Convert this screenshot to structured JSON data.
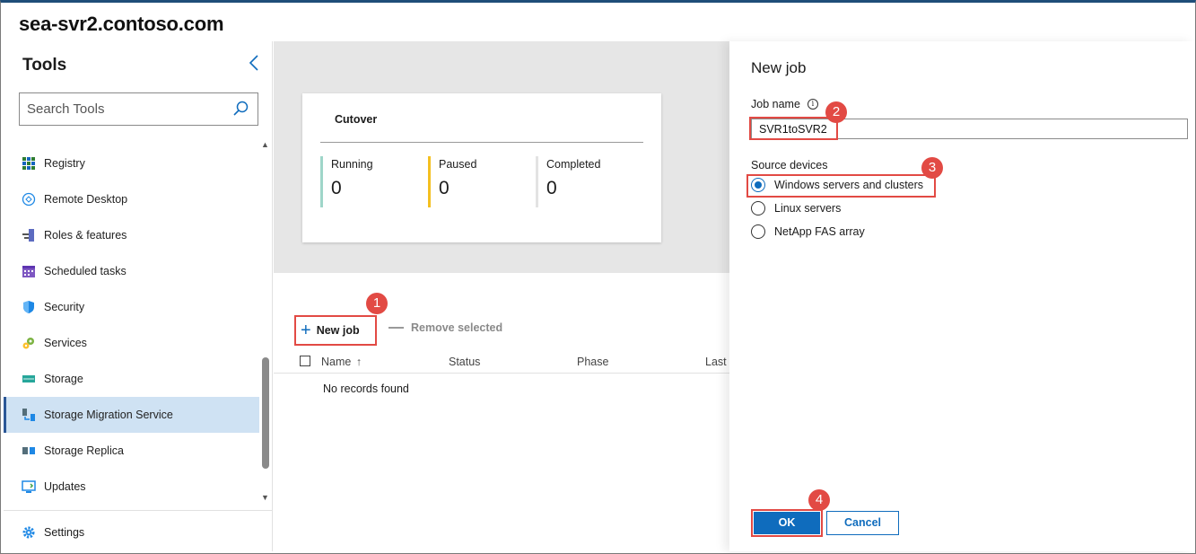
{
  "window": {
    "server_name": "sea-svr2.contoso.com"
  },
  "sidebar": {
    "title": "Tools",
    "search": {
      "placeholder": "Search Tools",
      "value": ""
    },
    "items": [
      {
        "label": "Registry",
        "icon": "registry-icon",
        "active": false
      },
      {
        "label": "Remote Desktop",
        "icon": "remote-desktop-icon",
        "active": false
      },
      {
        "label": "Roles & features",
        "icon": "roles-features-icon",
        "active": false
      },
      {
        "label": "Scheduled tasks",
        "icon": "calendar-icon",
        "active": false
      },
      {
        "label": "Security",
        "icon": "shield-icon",
        "active": false
      },
      {
        "label": "Services",
        "icon": "gears-icon",
        "active": false
      },
      {
        "label": "Storage",
        "icon": "storage-icon",
        "active": false
      },
      {
        "label": "Storage Migration Service",
        "icon": "migration-icon",
        "active": true
      },
      {
        "label": "Storage Replica",
        "icon": "replica-icon",
        "active": false
      },
      {
        "label": "Updates",
        "icon": "updates-icon",
        "active": false
      }
    ],
    "settings_label": "Settings"
  },
  "summary_card": {
    "title": "Cutover",
    "stats": [
      {
        "label": "Running",
        "value": "0",
        "color": "#9fd6c9"
      },
      {
        "label": "Paused",
        "value": "0",
        "color": "#f4c020"
      },
      {
        "label": "Completed",
        "value": "0",
        "color": "#e3e3e3"
      }
    ]
  },
  "toolbar": {
    "new_job_label": "New job",
    "remove_selected_label": "Remove selected"
  },
  "table": {
    "columns": [
      "Name",
      "Status",
      "Phase",
      "Last"
    ],
    "empty_text": "No records found"
  },
  "panel": {
    "title": "New job",
    "job_name_label": "Job name",
    "job_name_value": "SVR1toSVR2",
    "source_devices_label": "Source devices",
    "options": [
      {
        "label": "Windows servers and clusters",
        "selected": true
      },
      {
        "label": "Linux servers",
        "selected": false
      },
      {
        "label": "NetApp FAS array",
        "selected": false
      }
    ],
    "ok_label": "OK",
    "cancel_label": "Cancel"
  },
  "callouts": [
    "1",
    "2",
    "3",
    "4"
  ],
  "colors": {
    "accent": "#0f6cbd",
    "highlight": "#e24a44",
    "active_nav": "#cfe2f3"
  }
}
